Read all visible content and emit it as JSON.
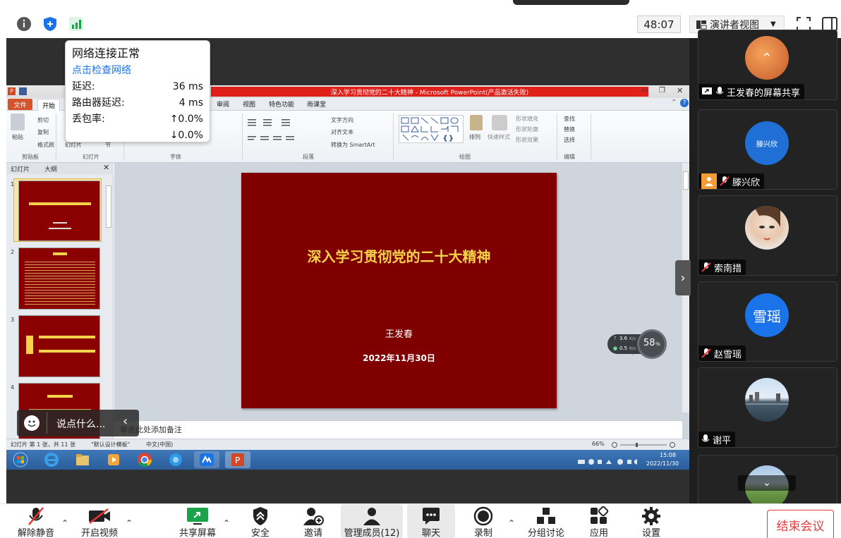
{
  "topbar": {
    "timer": "48:07",
    "view_label": "演讲者视图",
    "icons": [
      "info-icon",
      "shield-icon",
      "signal-icon",
      "fullscreen-icon",
      "panel-toggle-icon"
    ]
  },
  "network_popup": {
    "status": "网络连接正常",
    "check_link": "点击检查网络",
    "latency_label": "延迟:",
    "latency_value": "36 ms",
    "router_label": "路由器延迟:",
    "router_value": "4 ms",
    "loss_label": "丢包率:",
    "loss_up": "↑0.0%",
    "loss_down": "↓0.0%"
  },
  "ppt": {
    "window_title": "深入学习贯彻党的二十大精神 - Microsoft PowerPoint(产品激活失败)",
    "tabs": [
      "文件",
      "开始",
      "审阅",
      "视图",
      "特色功能",
      "雨课堂"
    ],
    "ribbon_groups": [
      "剪贴板",
      "幻灯片",
      "字体",
      "段落",
      "绘图",
      "编辑"
    ],
    "ribbon_items": {
      "paste": "粘贴",
      "cut": "剪切",
      "copy": "复制",
      "format_painter": "格式刷",
      "slide_label": "幻灯片",
      "section": "节",
      "text_direction": "文字方向",
      "align_text": "对齐文本",
      "smartart": "转换为 SmartArt",
      "arrange": "排列",
      "quick_styles": "快速样式",
      "shape_fill": "形状填充",
      "shape_outline": "形状轮廓",
      "shape_effects": "形状效果",
      "find": "查找",
      "replace": "替换",
      "select": "选择"
    },
    "pane_tabs": [
      "幻灯片",
      "大纲"
    ],
    "thumb_numbers": [
      "1",
      "2",
      "3",
      "4"
    ],
    "slide": {
      "title": "深入学习贯彻党的二十大精神",
      "author": "王发春",
      "date": "2022年11月30日"
    },
    "notes_placeholder": "单击此处添加备注",
    "status": {
      "slide_count": "幻灯片 第 1 张，共 11 张",
      "theme": "\"默认设计模板\"",
      "language": "中文(中国)",
      "zoom": "66%"
    },
    "clock_time": "15:08",
    "clock_date": "2022/11/30"
  },
  "speed_widget": {
    "up": "3.6",
    "down": "0.5",
    "unit": "K/s",
    "percent": "58",
    "percent_unit": "%"
  },
  "chat": {
    "placeholder": "说点什么..."
  },
  "participants": [
    {
      "name": "王发春的屏幕共享",
      "type": "share"
    },
    {
      "name": "滕兴欣",
      "avatar_text": "滕兴欣",
      "avatar_color": "#1f6fd6"
    },
    {
      "name": "索南措",
      "type": "photo"
    },
    {
      "name": "赵雪瑶",
      "avatar_text": "雪瑶",
      "avatar_color": "#1a73e8"
    },
    {
      "name": "谢平",
      "type": "photo"
    },
    {
      "name": "",
      "type": "photo"
    }
  ],
  "toolbar": {
    "unmute": "解除静音",
    "video": "开启视频",
    "share": "共享屏幕",
    "security": "安全",
    "invite": "邀请",
    "members": "管理成员(12)",
    "chat": "聊天",
    "record": "录制",
    "breakout": "分组讨论",
    "apps": "应用",
    "settings": "设置",
    "end": "结束会议"
  },
  "colors": {
    "slide_bg": "#800000",
    "slide_title": "#f5d24a",
    "accent_blue": "#1a73e8",
    "end_red": "#e63b3b",
    "share_green": "#1aa34a"
  }
}
